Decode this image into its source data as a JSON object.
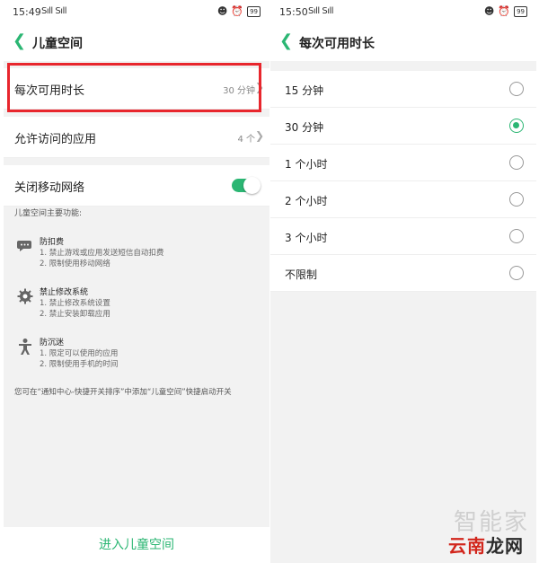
{
  "left": {
    "status_time": "15:49",
    "status_signal": "Sıll Sıll",
    "status_battery": "99",
    "title": "儿童空间",
    "rows": [
      {
        "label": "每次可用时长",
        "value": "30 分钟"
      },
      {
        "label": "允许访问的应用",
        "value": "4 个"
      },
      {
        "label": "关闭移动网络",
        "value": ""
      }
    ],
    "intro": "儿童空间主要功能:",
    "features": [
      {
        "name": "防扣费",
        "icon": "chat-bubble-icon",
        "lines": [
          "1. 禁止游戏或应用发送短信自动扣费",
          "2. 限制使用移动网络"
        ]
      },
      {
        "name": "禁止修改系统",
        "icon": "gear-icon",
        "lines": [
          "1. 禁止修改系统设置",
          "2. 禁止安装卸载应用"
        ]
      },
      {
        "name": "防沉迷",
        "icon": "person-icon",
        "lines": [
          "1. 限定可以使用的应用",
          "2. 限制使用手机的时间"
        ]
      }
    ],
    "note": "您可在“通知中心-快捷开关排序”中添加“儿童空间”快捷启动开关",
    "enter_button": "进入儿童空间"
  },
  "right": {
    "status_time": "15:50",
    "status_signal": "Sıll Sıll",
    "status_battery": "99",
    "title": "每次可用时长",
    "options": [
      {
        "label": "15 分钟",
        "selected": false
      },
      {
        "label": "30 分钟",
        "selected": true
      },
      {
        "label": "1 个小时",
        "selected": false
      },
      {
        "label": "2 个小时",
        "selected": false
      },
      {
        "label": "3 个小时",
        "selected": false
      },
      {
        "label": "不限制",
        "selected": false
      }
    ]
  },
  "watermark": {
    "top": "智能家",
    "bottom_red": "云南",
    "bottom_dark": "龙网"
  },
  "colors": {
    "accent": "#2bb673",
    "highlight": "#e8262d",
    "background": "#f2f2f2"
  }
}
